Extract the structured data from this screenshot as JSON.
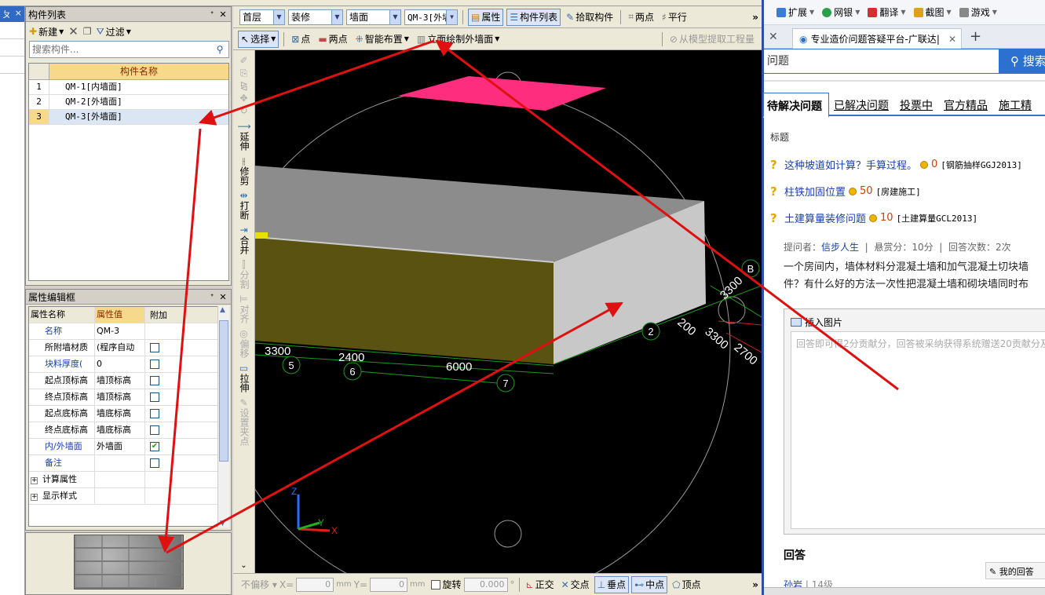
{
  "left_edge": {
    "header_label": "ㄆ",
    "close_label": "×"
  },
  "component_panel": {
    "title": "构件列表",
    "toolbar": {
      "new_label": "新建",
      "delete_icon": "close-icon",
      "filter_label": "过滤"
    },
    "search_placeholder": "搜索构件...",
    "column_header": "构件名称",
    "rows": [
      {
        "index": "1",
        "name": "QM-1[内墙面]"
      },
      {
        "index": "2",
        "name": "QM-2[外墙面]"
      },
      {
        "index": "3",
        "name": "QM-3[外墙面]"
      }
    ]
  },
  "property_panel": {
    "title": "属性编辑框",
    "headers": {
      "name": "属性名称",
      "value": "属性值",
      "extra": "附加"
    },
    "rows": [
      {
        "name": "名称",
        "value": "QM-3",
        "checked": null,
        "style": "blue"
      },
      {
        "name": "所附墙材质",
        "value": "(程序自动",
        "checked": false,
        "style": "black"
      },
      {
        "name": "块料厚度(",
        "value": "0",
        "checked": false,
        "style": "blue"
      },
      {
        "name": "起点顶标高",
        "value": "墙顶标高",
        "checked": false,
        "style": "black"
      },
      {
        "name": "终点顶标高",
        "value": "墙顶标高",
        "checked": false,
        "style": "black"
      },
      {
        "name": "起点底标高",
        "value": "墙底标高",
        "checked": false,
        "style": "black"
      },
      {
        "name": "终点底标高",
        "value": "墙底标高",
        "checked": false,
        "style": "black"
      },
      {
        "name": "内/外墙面",
        "value": "外墙面",
        "checked": true,
        "style": "blue"
      },
      {
        "name": "备注",
        "value": "",
        "checked": false,
        "style": "blue"
      }
    ],
    "groups": [
      "计算属性",
      "显示样式"
    ]
  },
  "cad_toolbar1": {
    "floor": "首层",
    "category": "装修",
    "type": "墙面",
    "component": "QM-3[外墙",
    "properties_label": "属性",
    "component_list_label": "构件列表",
    "pick_label": "拾取构件",
    "two_point_label": "两点",
    "parallel_label": "平行"
  },
  "cad_toolbar2": {
    "select_label": "选择",
    "point_label": "点",
    "two_point_label": "两点",
    "smart_layout_label": "智能布置",
    "elevation_label": "立面绘制外墙面",
    "extract_label": "从模型提取工程量"
  },
  "vertical_tools": [
    "延伸",
    "修剪",
    "打断",
    "合并",
    "分割",
    "对齐",
    "偏移",
    "拉伸",
    "设置夹点"
  ],
  "viewport": {
    "axis_labels": [
      "5",
      "6",
      "7",
      "2",
      "B"
    ],
    "dimensions": [
      "3300",
      "2400",
      "6000",
      "200",
      "3300",
      "2700",
      "3300"
    ],
    "axis_x": "X",
    "axis_y": "Y",
    "axis_z": "Z"
  },
  "statusbar": {
    "offset_label": "不偏移",
    "x_label": "X=",
    "x_value": "0",
    "mm1": "mm",
    "y_label": "Y=",
    "y_value": "0",
    "mm2": "mm",
    "rotate_label": "旋转",
    "rotate_value": "0.000",
    "ortho_label": "正交",
    "intersect_label": "交点",
    "perp_label": "垂点",
    "mid_label": "中点",
    "vertex_label": "顶点"
  },
  "browser": {
    "bookmarks": [
      "扩展",
      "网银",
      "翻译",
      "截图",
      "游戏"
    ],
    "tab_title": "专业造价问题答疑平台-广联达|",
    "search_text": "问题",
    "search_button": "搜索",
    "question_tabs": [
      "待解决问题",
      "已解决问题",
      "投票中",
      "官方精品",
      "施工精"
    ],
    "column_title": "标题",
    "questions": [
      {
        "title": "这种坡道如计算？手算过程。",
        "points": "0",
        "category": "[钢筋抽样GGJ2013]"
      },
      {
        "title": "柱铁加固位置",
        "points": "50",
        "category": "[房建施工]"
      },
      {
        "title": "土建算量装修问题",
        "points": "10",
        "category": "[土建算量GCL2013]"
      }
    ],
    "asker_prefix": "提问者：",
    "asker": "信步人生",
    "reward": "悬赏分：10分",
    "answer_count": "回答次数：2次",
    "question_body": "一个房间内，墙体材料分混凝土墙和加气混凝土切块墙件？有什么好的方法一次性把混凝土墙和砌块墙同时布",
    "insert_image_label": "插入图片",
    "answer_placeholder": "回答即可得2分贡献分，回答被采纳获得系统赠送20贡献分及",
    "answers_heading": "回答",
    "answerer": "孙岩",
    "answerer_level": "14级",
    "my_answer_label": "我的回答"
  },
  "colors": {
    "annotation_arrow": "#e01010",
    "magenta_slab": "#ff2d7d",
    "olive_face": "#5a5210",
    "wall_top": "#8c8c8c",
    "wall_side": "#c8c8c8",
    "accent_blue": "#2c70d0"
  }
}
